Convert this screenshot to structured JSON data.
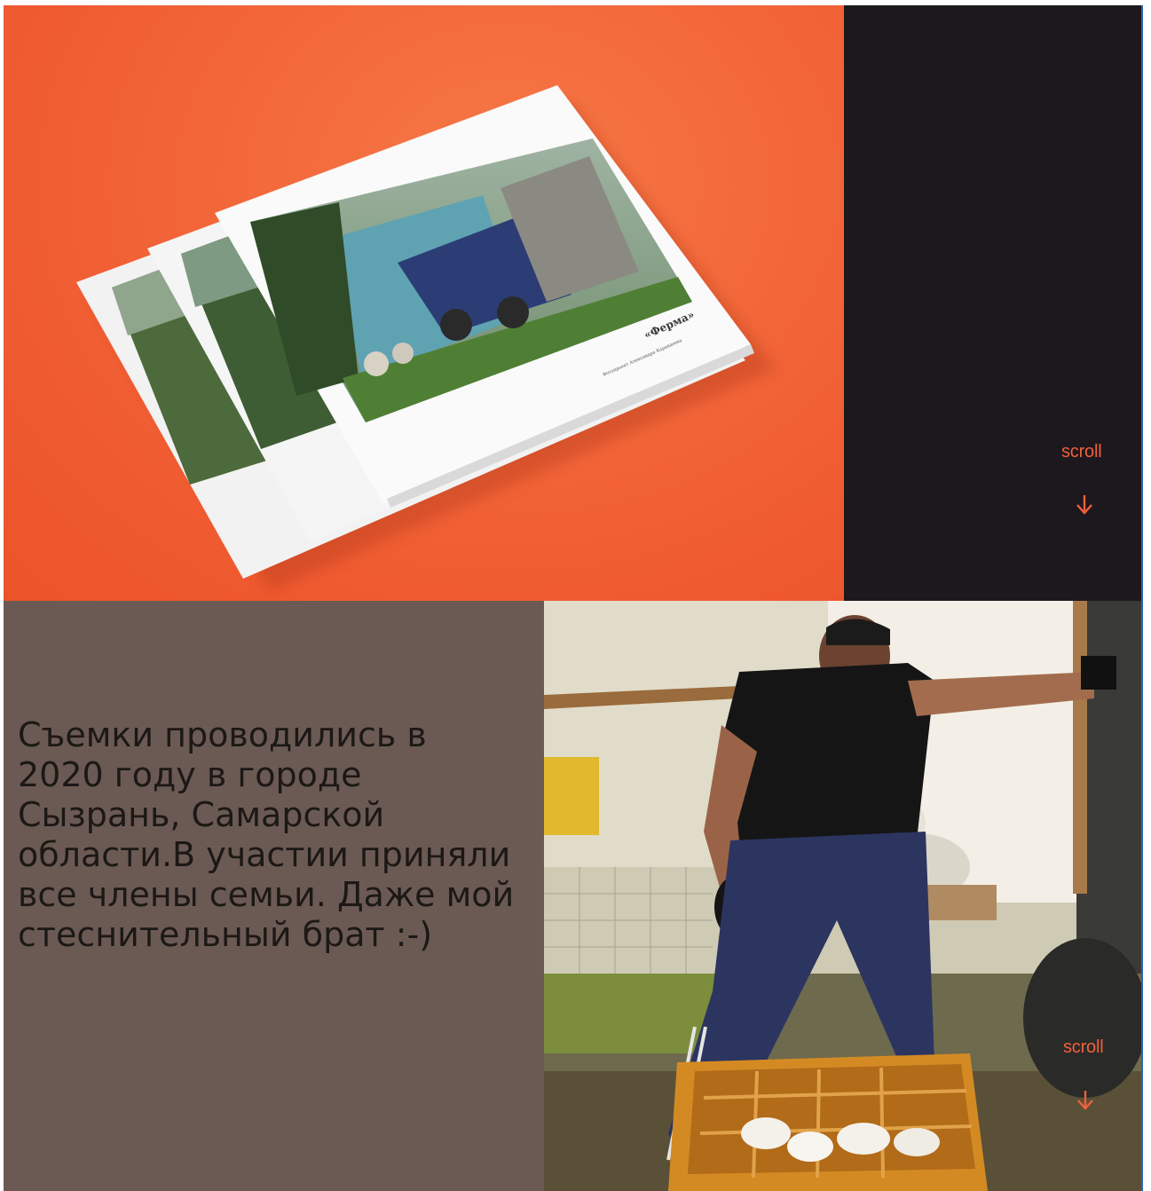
{
  "hero": {
    "book_title": "«Ферма»",
    "book_subtitle": "Фотопроект Александра Карандеева"
  },
  "scroll_top": {
    "label": "scroll",
    "icon": "arrow-down-icon"
  },
  "about": {
    "text": "Съемки проводились в 2020 году в городе Сызрань, Самарской области.В участии приняли все члены семьи. Даже мой стеснительный брат :-)"
  },
  "scroll_bottom": {
    "label": "scroll",
    "icon": "arrow-down-icon"
  },
  "colors": {
    "accent": "#f0603b",
    "hero_bg": "#f05b31",
    "dark_panel": "#1d181d",
    "text_panel": "#6b5a53"
  }
}
